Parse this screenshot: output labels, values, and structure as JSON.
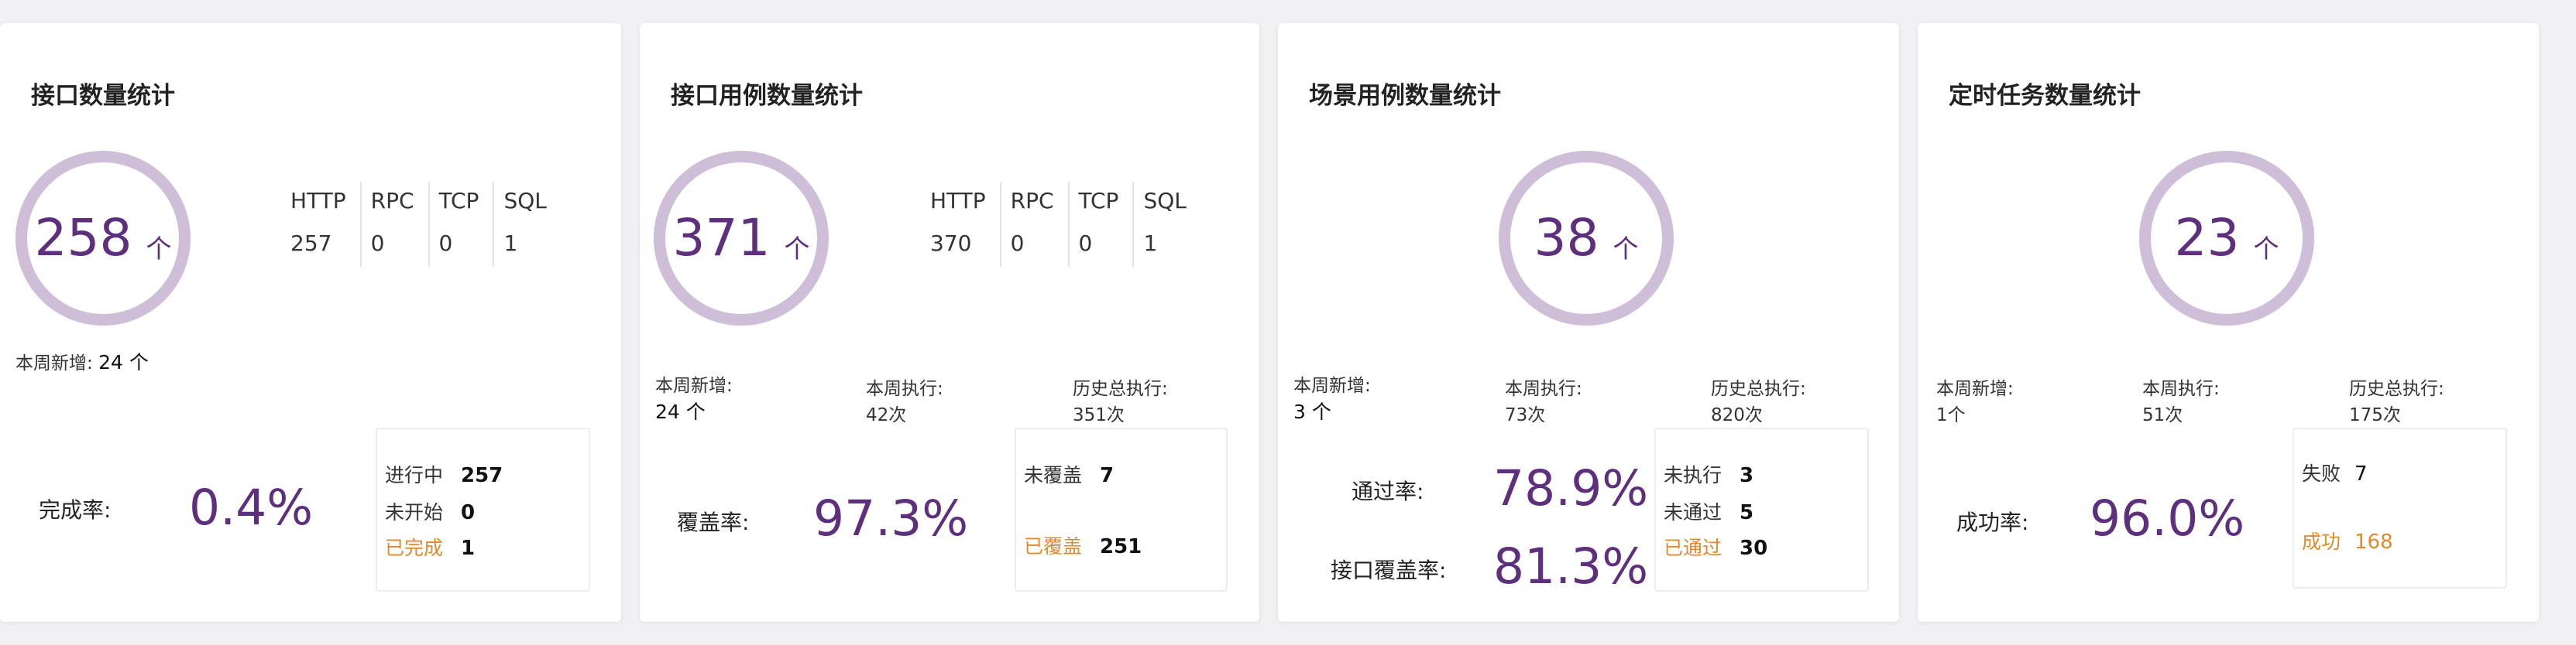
{
  "colors": {
    "accent": "#5e2f7c",
    "ring": "#cfbed8",
    "done": "#e28a2b"
  },
  "cards": [
    {
      "title": "接口数量统计",
      "count": "258",
      "unit": "个",
      "types": {
        "headers": [
          "HTTP",
          "RPC",
          "TCP",
          "SQL"
        ],
        "values": [
          "257",
          "0",
          "0",
          "1"
        ]
      },
      "weekly_new_label": "本周新增:",
      "weekly_new_value": "24 个",
      "rates": [
        {
          "label": "完成率:",
          "value": "0.4%"
        }
      ],
      "status": [
        {
          "label": "进行中",
          "value": "257"
        },
        {
          "label": "未开始",
          "value": "0"
        },
        {
          "label": "已完成",
          "value": "1"
        }
      ]
    },
    {
      "title": "接口用例数量统计",
      "count": "371",
      "unit": "个",
      "types": {
        "headers": [
          "HTTP",
          "RPC",
          "TCP",
          "SQL"
        ],
        "values": [
          "370",
          "0",
          "0",
          "1"
        ]
      },
      "weekly_new_label": "本周新增:",
      "weekly_new_value": "24 个",
      "week_exec_label": "本周执行:",
      "week_exec_value": "42次",
      "history_exec_label": "历史总执行:",
      "history_exec_value": "351次",
      "rates": [
        {
          "label": "覆盖率:",
          "value": "97.3%"
        }
      ],
      "status": [
        {
          "label": "未覆盖",
          "value": "7"
        },
        {
          "label": "已覆盖",
          "value": "251"
        }
      ]
    },
    {
      "title": "场景用例数量统计",
      "count": "38",
      "unit": "个",
      "weekly_new_label": "本周新增:",
      "weekly_new_value": "3 个",
      "week_exec_label": "本周执行:",
      "week_exec_value": "73次",
      "history_exec_label": "历史总执行:",
      "history_exec_value": "820次",
      "rates": [
        {
          "label": "通过率:",
          "value": "78.9%"
        },
        {
          "label": "接口覆盖率:",
          "value": "81.3%"
        }
      ],
      "status": [
        {
          "label": "未执行",
          "value": "3"
        },
        {
          "label": "未通过",
          "value": "5"
        },
        {
          "label": "已通过",
          "value": "30"
        }
      ]
    },
    {
      "title": "定时任务数量统计",
      "count": "23",
      "unit": "个",
      "weekly_new_label": "本周新增:",
      "weekly_new_value": "1个",
      "week_exec_label": "本周执行:",
      "week_exec_value": "51次",
      "history_exec_label": "历史总执行:",
      "history_exec_value": "175次",
      "rates": [
        {
          "label": "成功率:",
          "value": "96.0%"
        }
      ],
      "status": [
        {
          "label": "失败",
          "value": "7"
        },
        {
          "label": "成功",
          "value": "168"
        }
      ]
    }
  ]
}
